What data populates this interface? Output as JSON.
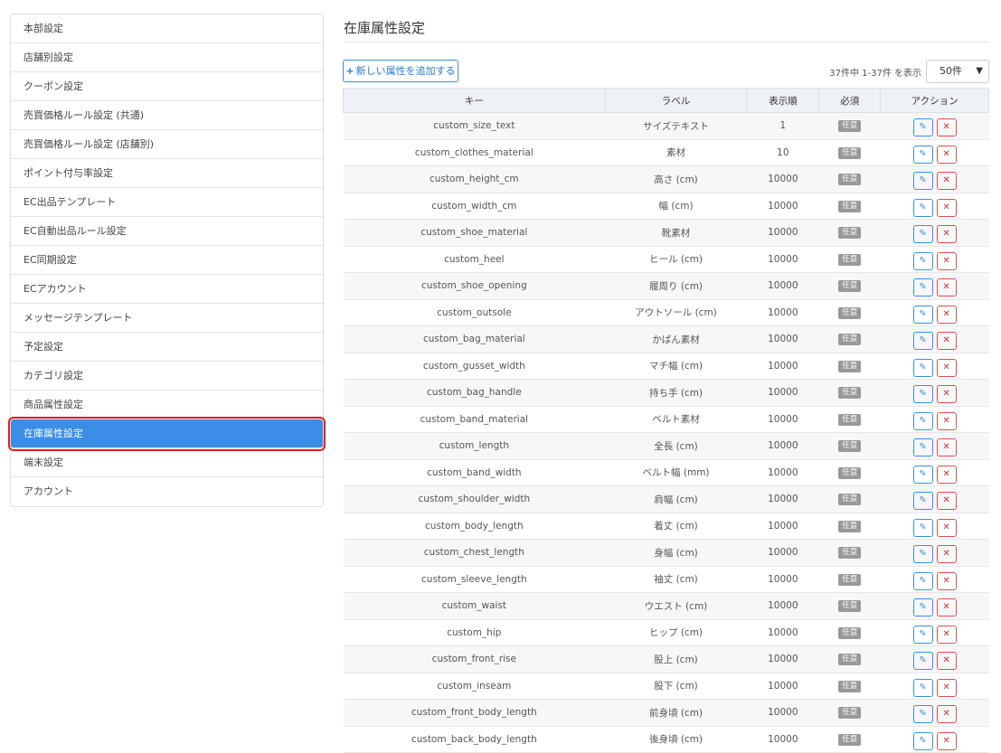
{
  "sidebar": {
    "items": [
      {
        "label": "本部設定"
      },
      {
        "label": "店舗別設定"
      },
      {
        "label": "クーポン設定"
      },
      {
        "label": "売買価格ルール設定 (共通)"
      },
      {
        "label": "売買価格ルール設定 (店舗別)"
      },
      {
        "label": "ポイント付与率設定"
      },
      {
        "label": "EC出品テンプレート"
      },
      {
        "label": "EC自動出品ルール設定"
      },
      {
        "label": "EC同期設定"
      },
      {
        "label": "ECアカウント"
      },
      {
        "label": "メッセージテンプレート"
      },
      {
        "label": "予定設定"
      },
      {
        "label": "カテゴリ設定"
      },
      {
        "label": "商品属性設定"
      },
      {
        "label": "在庫属性設定",
        "active": true
      },
      {
        "label": "端末設定"
      },
      {
        "label": "アカウント"
      }
    ]
  },
  "main": {
    "title": "在庫属性設定",
    "add_button_label": "新しい属性を追加する",
    "count_text": "37件中 1-37件 を表示",
    "per_page": "50件"
  },
  "table": {
    "headers": {
      "key": "キー",
      "label": "ラベル",
      "order": "表示順",
      "required": "必須",
      "actions": "アクション"
    },
    "rows": [
      {
        "key": "custom_size_text",
        "label": "サイズテキスト",
        "order": "1",
        "required": "任意"
      },
      {
        "key": "custom_clothes_material",
        "label": "素材",
        "order": "10",
        "required": "任意"
      },
      {
        "key": "custom_height_cm",
        "label": "高さ (cm)",
        "order": "10000",
        "required": "任意"
      },
      {
        "key": "custom_width_cm",
        "label": "幅 (cm)",
        "order": "10000",
        "required": "任意"
      },
      {
        "key": "custom_shoe_material",
        "label": "靴素材",
        "order": "10000",
        "required": "任意"
      },
      {
        "key": "custom_heel",
        "label": "ヒール (cm)",
        "order": "10000",
        "required": "任意"
      },
      {
        "key": "custom_shoe_opening",
        "label": "履周り (cm)",
        "order": "10000",
        "required": "任意"
      },
      {
        "key": "custom_outsole",
        "label": "アウトソール (cm)",
        "order": "10000",
        "required": "任意"
      },
      {
        "key": "custom_bag_material",
        "label": "かばん素材",
        "order": "10000",
        "required": "任意"
      },
      {
        "key": "custom_gusset_width",
        "label": "マチ幅 (cm)",
        "order": "10000",
        "required": "任意"
      },
      {
        "key": "custom_bag_handle",
        "label": "持ち手 (cm)",
        "order": "10000",
        "required": "任意"
      },
      {
        "key": "custom_band_material",
        "label": "ベルト素材",
        "order": "10000",
        "required": "任意"
      },
      {
        "key": "custom_length",
        "label": "全長 (cm)",
        "order": "10000",
        "required": "任意"
      },
      {
        "key": "custom_band_width",
        "label": "ベルト幅 (mm)",
        "order": "10000",
        "required": "任意"
      },
      {
        "key": "custom_shoulder_width",
        "label": "肩幅 (cm)",
        "order": "10000",
        "required": "任意"
      },
      {
        "key": "custom_body_length",
        "label": "着丈 (cm)",
        "order": "10000",
        "required": "任意"
      },
      {
        "key": "custom_chest_length",
        "label": "身幅 (cm)",
        "order": "10000",
        "required": "任意"
      },
      {
        "key": "custom_sleeve_length",
        "label": "袖丈 (cm)",
        "order": "10000",
        "required": "任意"
      },
      {
        "key": "custom_waist",
        "label": "ウエスト (cm)",
        "order": "10000",
        "required": "任意"
      },
      {
        "key": "custom_hip",
        "label": "ヒップ (cm)",
        "order": "10000",
        "required": "任意"
      },
      {
        "key": "custom_front_rise",
        "label": "股上 (cm)",
        "order": "10000",
        "required": "任意"
      },
      {
        "key": "custom_inseam",
        "label": "股下 (cm)",
        "order": "10000",
        "required": "任意"
      },
      {
        "key": "custom_front_body_length",
        "label": "前身頃 (cm)",
        "order": "10000",
        "required": "任意"
      },
      {
        "key": "custom_back_body_length",
        "label": "後身頃 (cm)",
        "order": "10000",
        "required": "任意"
      }
    ]
  },
  "icons": {
    "add": "plus-icon",
    "edit": "pencil-icon",
    "delete": "close-icon",
    "per_page": "chevron-down-icon"
  },
  "colors": {
    "accent": "#3a8ee6",
    "danger": "#d93030",
    "active_outline": "#e02020",
    "badge": "#999999"
  }
}
